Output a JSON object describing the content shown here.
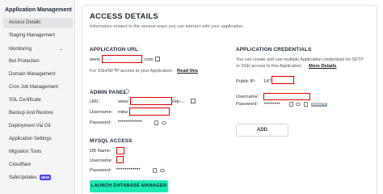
{
  "sidebar": {
    "title": "Application Management",
    "items": [
      {
        "label": "Access Details",
        "active": true
      },
      {
        "label": "Staging Management"
      },
      {
        "label": "Monitoring"
      },
      {
        "label": "Bot Protection"
      },
      {
        "label": "Domain Management"
      },
      {
        "label": "Cron Job Management"
      },
      {
        "label": "SSL Certificate"
      },
      {
        "label": "Backup And Restore"
      },
      {
        "label": "Deployment Via Git"
      },
      {
        "label": "Application Settings"
      },
      {
        "label": "Migration Tools"
      },
      {
        "label": "Cloudflare"
      },
      {
        "label": "SafeUpdates",
        "badge": "NEW"
      }
    ]
  },
  "main": {
    "title": "ACCESS DETAILS",
    "subtitle": "Information related to the several ways you can interact with your application.",
    "app_url": {
      "heading": "APPLICATION URL",
      "prefix": "www.",
      "suffix": ".com",
      "note": "For SSH/SFTP access to your Application.",
      "read_this": "Read this"
    },
    "admin_panel": {
      "heading": "ADMIN PANEL",
      "url_label": "URL:",
      "url_prefix": "www.",
      "url_suffix": "/wp-...",
      "username_label": "Username:",
      "username_prefix": "mike",
      "password_label": "Password:",
      "password_mask": "••••••••••••"
    },
    "mysql": {
      "heading": "MYSQL ACCESS",
      "db_label": "DB Name:",
      "username_label": "Username:",
      "password_label": "Password:",
      "password_mask": "••••••••••••"
    },
    "launch_button": "LAUNCH DATABASE MANAGER",
    "credentials": {
      "heading": "APPLICATION CREDENTIALS",
      "description_line1": "You can create and use multiple Application credentials for SFTP",
      "description_line2": "or SSH access to this Application.",
      "more_details": "More Details",
      "public_ip_label": "Public IP:",
      "public_ip_prefix": "147.",
      "username_label": "Username:",
      "password_label": "Password:",
      "password_mask": "••••••••",
      "ssh_badge": "SSH/SFTP",
      "add_button": "ADD"
    }
  }
}
